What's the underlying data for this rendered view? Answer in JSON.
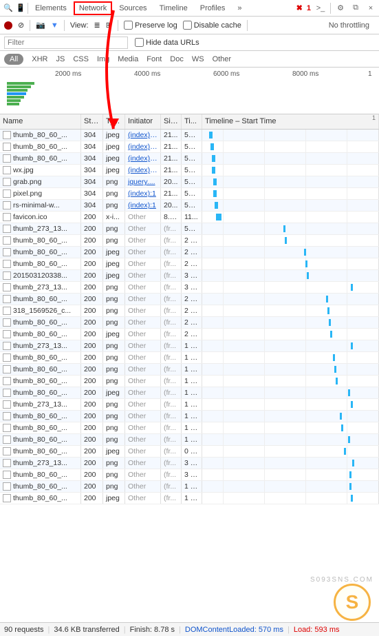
{
  "tabs": {
    "elements": "Elements",
    "network": "Network",
    "sources": "Sources",
    "timeline": "Timeline",
    "profiles": "Profiles",
    "more": "»"
  },
  "topIcons": {
    "search": "🔍",
    "device": "📱",
    "errCount": "1",
    "console": ">_",
    "gear": "⚙",
    "dock": "⧉",
    "close": "×"
  },
  "toolbar": {
    "clear": "⊘",
    "camera": "📷",
    "view": "View:",
    "list": "≣",
    "grid": "⊞",
    "preserve": "Preserve log",
    "disable": "Disable cache",
    "throttle": "No throttling"
  },
  "filter": {
    "placeholder": "Filter",
    "hide": "Hide data URLs"
  },
  "types": {
    "all": "All",
    "xhr": "XHR",
    "js": "JS",
    "css": "CSS",
    "img": "Img",
    "media": "Media",
    "font": "Font",
    "doc": "Doc",
    "ws": "WS",
    "other": "Other"
  },
  "overviewTicks": [
    "2000 ms",
    "4000 ms",
    "6000 ms",
    "8000 ms",
    "1"
  ],
  "columns": {
    "name": "Name",
    "status": "Sta...",
    "type": "Ty...",
    "initiator": "Initiator",
    "size": "Size",
    "time": "Ti...",
    "timeline": "Timeline – Start Time"
  },
  "tlOne": "1",
  "rows": [
    {
      "name": "thumb_80_60_...",
      "status": "304",
      "type": "jpeg",
      "init": "(index):...",
      "link": 1,
      "size": "21...",
      "time": "55 ...",
      "bar": [
        10,
        5
      ]
    },
    {
      "name": "thumb_80_60_...",
      "status": "304",
      "type": "jpeg",
      "init": "(index):...",
      "link": 1,
      "size": "21...",
      "time": "56 ...",
      "bar": [
        12,
        5
      ]
    },
    {
      "name": "thumb_80_60_...",
      "status": "304",
      "type": "jpeg",
      "init": "(index):...",
      "link": 1,
      "size": "21...",
      "time": "55 ...",
      "bar": [
        14,
        5
      ]
    },
    {
      "name": "wx.jpg",
      "status": "304",
      "type": "jpeg",
      "init": "(index):...",
      "link": 1,
      "size": "21...",
      "time": "58 ...",
      "bar": [
        14,
        5
      ]
    },
    {
      "name": "grab.png",
      "status": "304",
      "type": "png",
      "init": "jquery....",
      "link": 1,
      "size": "20...",
      "time": "56 ...",
      "bar": [
        16,
        5
      ]
    },
    {
      "name": "pixel.png",
      "status": "304",
      "type": "png",
      "init": "(index):1",
      "link": 1,
      "size": "21...",
      "time": "59 ...",
      "bar": [
        16,
        5
      ]
    },
    {
      "name": "rs-minimal-w...",
      "status": "304",
      "type": "png",
      "init": "(index):1",
      "link": 1,
      "size": "20...",
      "time": "53 ...",
      "bar": [
        18,
        5
      ]
    },
    {
      "name": "favicon.ico",
      "status": "200",
      "type": "x-i...",
      "init": "Other",
      "link": 0,
      "size": "8.5...",
      "time": "11...",
      "bar": [
        20,
        8
      ]
    },
    {
      "name": "thumb_273_13...",
      "status": "200",
      "type": "png",
      "init": "Other",
      "link": 0,
      "size": "(fr...",
      "time": "56 ...",
      "bar": [
        118,
        3
      ]
    },
    {
      "name": "thumb_80_60_...",
      "status": "200",
      "type": "png",
      "init": "Other",
      "link": 0,
      "size": "(fr...",
      "time": "2 ms",
      "bar": [
        120,
        3
      ]
    },
    {
      "name": "thumb_80_60_...",
      "status": "200",
      "type": "jpeg",
      "init": "Other",
      "link": 0,
      "size": "(fr...",
      "time": "2 ms",
      "bar": [
        148,
        3
      ]
    },
    {
      "name": "thumb_80_60_...",
      "status": "200",
      "type": "jpeg",
      "init": "Other",
      "link": 0,
      "size": "(fr...",
      "time": "2 ms",
      "bar": [
        150,
        3
      ]
    },
    {
      "name": "201503120338...",
      "status": "200",
      "type": "jpeg",
      "init": "Other",
      "link": 0,
      "size": "(fr...",
      "time": "3 ms",
      "bar": [
        152,
        3
      ]
    },
    {
      "name": "thumb_273_13...",
      "status": "200",
      "type": "png",
      "init": "Other",
      "link": 0,
      "size": "(fr...",
      "time": "3 ms",
      "bar": [
        216,
        3
      ]
    },
    {
      "name": "thumb_80_60_...",
      "status": "200",
      "type": "png",
      "init": "Other",
      "link": 0,
      "size": "(fr...",
      "time": "2 ms",
      "bar": [
        180,
        3
      ]
    },
    {
      "name": "318_1569526_c...",
      "status": "200",
      "type": "png",
      "init": "Other",
      "link": 0,
      "size": "(fr...",
      "time": "2 ms",
      "bar": [
        182,
        3
      ]
    },
    {
      "name": "thumb_80_60_...",
      "status": "200",
      "type": "png",
      "init": "Other",
      "link": 0,
      "size": "(fr...",
      "time": "2 ms",
      "bar": [
        184,
        3
      ]
    },
    {
      "name": "thumb_80_60_...",
      "status": "200",
      "type": "jpeg",
      "init": "Other",
      "link": 0,
      "size": "(fr...",
      "time": "2 ms",
      "bar": [
        186,
        3
      ]
    },
    {
      "name": "thumb_273_13...",
      "status": "200",
      "type": "png",
      "init": "Other",
      "link": 0,
      "size": "(fr...",
      "time": "1 ms",
      "bar": [
        216,
        3
      ]
    },
    {
      "name": "thumb_80_60_...",
      "status": "200",
      "type": "png",
      "init": "Other",
      "link": 0,
      "size": "(fr...",
      "time": "1 ms",
      "bar": [
        190,
        3
      ]
    },
    {
      "name": "thumb_80_60_...",
      "status": "200",
      "type": "png",
      "init": "Other",
      "link": 0,
      "size": "(fr...",
      "time": "1 ms",
      "bar": [
        192,
        3
      ]
    },
    {
      "name": "thumb_80_60_...",
      "status": "200",
      "type": "png",
      "init": "Other",
      "link": 0,
      "size": "(fr...",
      "time": "1 ms",
      "bar": [
        194,
        3
      ]
    },
    {
      "name": "thumb_80_60_...",
      "status": "200",
      "type": "jpeg",
      "init": "Other",
      "link": 0,
      "size": "(fr...",
      "time": "1 ms",
      "bar": [
        212,
        3
      ]
    },
    {
      "name": "thumb_273_13...",
      "status": "200",
      "type": "png",
      "init": "Other",
      "link": 0,
      "size": "(fr...",
      "time": "1 ms",
      "bar": [
        216,
        3
      ]
    },
    {
      "name": "thumb_80_60_...",
      "status": "200",
      "type": "png",
      "init": "Other",
      "link": 0,
      "size": "(fr...",
      "time": "1 ms",
      "bar": [
        200,
        3
      ]
    },
    {
      "name": "thumb_80_60_...",
      "status": "200",
      "type": "png",
      "init": "Other",
      "link": 0,
      "size": "(fr...",
      "time": "1 ms",
      "bar": [
        202,
        3
      ]
    },
    {
      "name": "thumb_80_60_...",
      "status": "200",
      "type": "png",
      "init": "Other",
      "link": 0,
      "size": "(fr...",
      "time": "1 ms",
      "bar": [
        212,
        3
      ]
    },
    {
      "name": "thumb_80_60_...",
      "status": "200",
      "type": "jpeg",
      "init": "Other",
      "link": 0,
      "size": "(fr...",
      "time": "0 ms",
      "bar": [
        206,
        3
      ]
    },
    {
      "name": "thumb_273_13...",
      "status": "200",
      "type": "png",
      "init": "Other",
      "link": 0,
      "size": "(fr...",
      "time": "3 ms",
      "bar": [
        218,
        3
      ]
    },
    {
      "name": "thumb_80_60_...",
      "status": "200",
      "type": "png",
      "init": "Other",
      "link": 0,
      "size": "(fr...",
      "time": "3 ms",
      "bar": [
        214,
        3
      ]
    },
    {
      "name": "thumb_80_60_...",
      "status": "200",
      "type": "png",
      "init": "Other",
      "link": 0,
      "size": "(fr...",
      "time": "1 ms",
      "bar": [
        214,
        3
      ]
    },
    {
      "name": "thumb_80_60_...",
      "status": "200",
      "type": "jpeg",
      "init": "Other",
      "link": 0,
      "size": "(fr...",
      "time": "1 ms",
      "bar": [
        216,
        3
      ]
    }
  ],
  "footer": {
    "req": "90 requests",
    "xfer": "34.6 KB transferred",
    "finish": "Finish: 8.78 s",
    "dcl": "DOMContentLoaded: 570 ms",
    "load": "Load: 593 ms"
  },
  "watermark": "S",
  "wmtext": "S093SNS.COM"
}
